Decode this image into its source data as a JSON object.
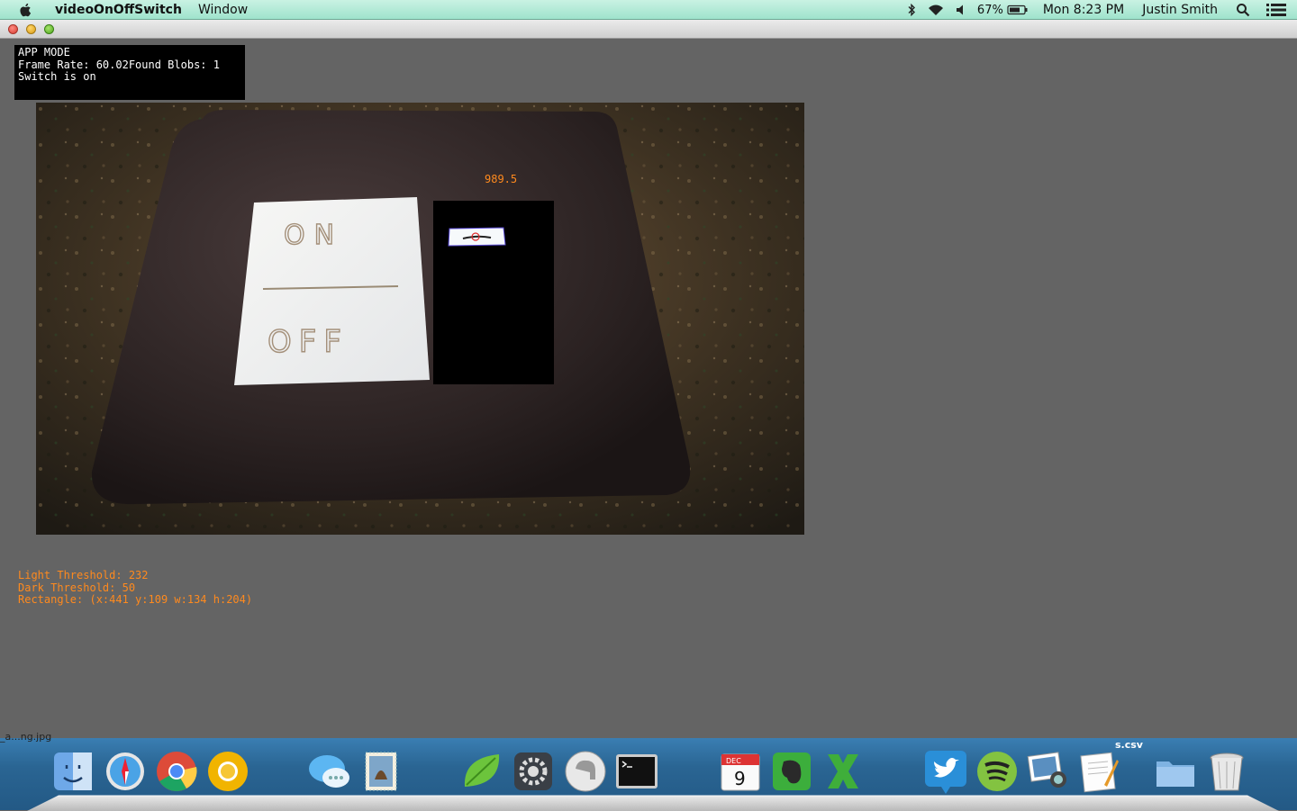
{
  "menubar": {
    "app_name": "videoOnOffSwitch",
    "menu_window": "Window",
    "battery_percent": "67%",
    "clock": "Mon 8:23 PM",
    "user": "Justin Smith"
  },
  "hud": {
    "line1": "APP MODE",
    "line2": "Frame Rate: 60.02Found Blobs: 1",
    "line3": "Switch is on"
  },
  "video": {
    "paper_top_text": "ON",
    "paper_bottom_text": "OFF",
    "blob_area_label": "989.5"
  },
  "settings": {
    "light_threshold": "Light Threshold: 232",
    "dark_threshold": "Dark Threshold: 50",
    "rectangle": "Rectangle: (x:441 y:109 w:134 h:204)"
  },
  "desktop": {
    "partial_filename": "_a...ng.jpg",
    "file_label": "s.csv"
  },
  "dock": {
    "calendar_month": "DEC",
    "calendar_day": "9",
    "items": [
      "finder-icon",
      "safari-icon",
      "chrome-icon",
      "chrome-canary-icon",
      "messages-icon",
      "mail-icon",
      "coda-icon",
      "system-preferences-icon",
      "sequel-pro-icon",
      "terminal-icon",
      "calendar-icon",
      "evernote-icon",
      "excel-icon",
      "twitter-icon",
      "spotify-icon",
      "iphoto-icon",
      "textedit-icon",
      "folder-icon",
      "trash-icon"
    ]
  },
  "colors": {
    "menubar_bg": "#b8edd9",
    "window_bg": "#646464",
    "overlay_text": "#ff8a1e",
    "hud_bg": "#000000"
  }
}
